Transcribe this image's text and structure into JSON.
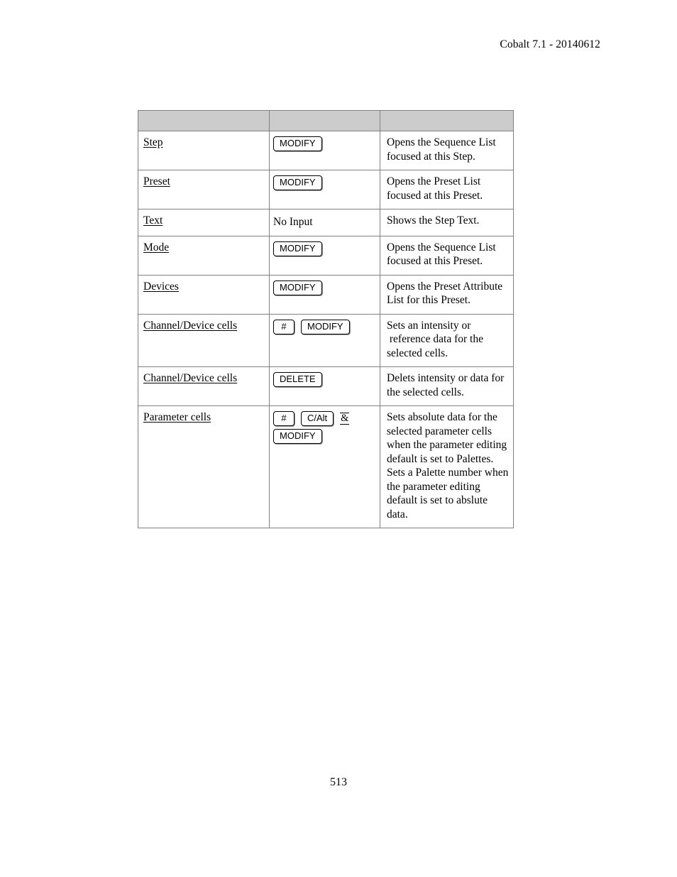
{
  "header": {
    "running_head": "Cobalt 7.1 - 20140612"
  },
  "table": {
    "columns": [
      "",
      "",
      ""
    ],
    "rows": [
      {
        "action": "Step",
        "keys": [
          {
            "type": "keyrow",
            "items": [
              {
                "kind": "key",
                "label": "MODIFY"
              }
            ]
          }
        ],
        "description": [
          "Opens the Sequence List",
          "focused at this Step."
        ]
      },
      {
        "action": "Preset",
        "keys": [
          {
            "type": "keyrow",
            "items": [
              {
                "kind": "key",
                "label": "MODIFY"
              }
            ]
          }
        ],
        "description": [
          "Opens the Preset List",
          "focused at this Preset."
        ]
      },
      {
        "action": "Text",
        "keys": [
          {
            "type": "keyrow",
            "items": [
              {
                "kind": "text",
                "label": "No Input"
              }
            ]
          }
        ],
        "description": [
          "Shows the Step Text."
        ]
      },
      {
        "action": "Mode",
        "keys": [
          {
            "type": "keyrow",
            "items": [
              {
                "kind": "key",
                "label": "MODIFY"
              }
            ]
          }
        ],
        "description": [
          "Opens the Sequence List",
          "focused at this Preset."
        ]
      },
      {
        "action": "Devices",
        "keys": [
          {
            "type": "keyrow",
            "items": [
              {
                "kind": "key",
                "label": "MODIFY"
              }
            ]
          }
        ],
        "description": [
          "Opens the Preset Attribute",
          "List for this Preset."
        ]
      },
      {
        "action": "Channel/Device cells",
        "keys": [
          {
            "type": "keyrow",
            "items": [
              {
                "kind": "key",
                "label": "#",
                "narrow": true
              },
              {
                "kind": "key",
                "label": "MODIFY"
              }
            ]
          }
        ],
        "description": [
          "Sets an intensity or",
          " reference data for the",
          "selected cells."
        ]
      },
      {
        "action": "Channel/Device cells",
        "keys": [
          {
            "type": "keyrow",
            "items": [
              {
                "kind": "key",
                "label": "DELETE"
              }
            ]
          }
        ],
        "description": [
          "Delets intensity or data for",
          "the selected cells."
        ]
      },
      {
        "action": "Parameter cells",
        "keys": [
          {
            "type": "keyrow",
            "items": [
              {
                "kind": "key",
                "label": "#",
                "narrow": true
              },
              {
                "kind": "key",
                "label": "C/Alt"
              },
              {
                "kind": "amp",
                "label": "&"
              }
            ]
          },
          {
            "type": "keyrow",
            "items": [
              {
                "kind": "key",
                "label": "MODIFY"
              }
            ]
          }
        ],
        "description": [
          "Sets absolute data for the",
          "selected parameter cells",
          "when the parameter editing",
          "default is set to Palettes.",
          "Sets a Palette number when",
          "the parameter editing",
          "default is set to abslute",
          "data."
        ]
      }
    ]
  },
  "footer": {
    "page_number": "513"
  },
  "colors": {
    "header_row_fill": "#cccccc",
    "border": "#808080",
    "text": "#000000",
    "key_shadow": "#9a9a9a"
  }
}
